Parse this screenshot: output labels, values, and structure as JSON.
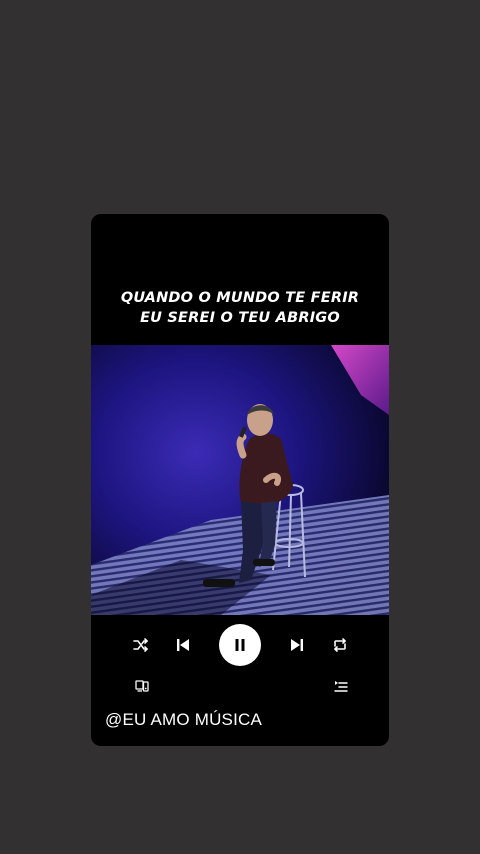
{
  "lyrics": {
    "line1": "QUANDO O MUNDO TE FERIR",
    "line2": "EU SEREI O TEU ABRIGO"
  },
  "player": {
    "state": "playing",
    "controls": {
      "shuffle": "shuffle-icon",
      "previous": "skip-previous-icon",
      "play_pause": "pause-icon",
      "next": "skip-next-icon",
      "repeat": "repeat-icon"
    },
    "secondary": {
      "devices": "devices-icon",
      "queue": "queue-icon"
    }
  },
  "watermark": "@EU AMO MÚSICA",
  "colors": {
    "background": "#323030",
    "card": "#000000",
    "stage_purple": "#3a1fa8",
    "play_button": "#ffffff"
  }
}
